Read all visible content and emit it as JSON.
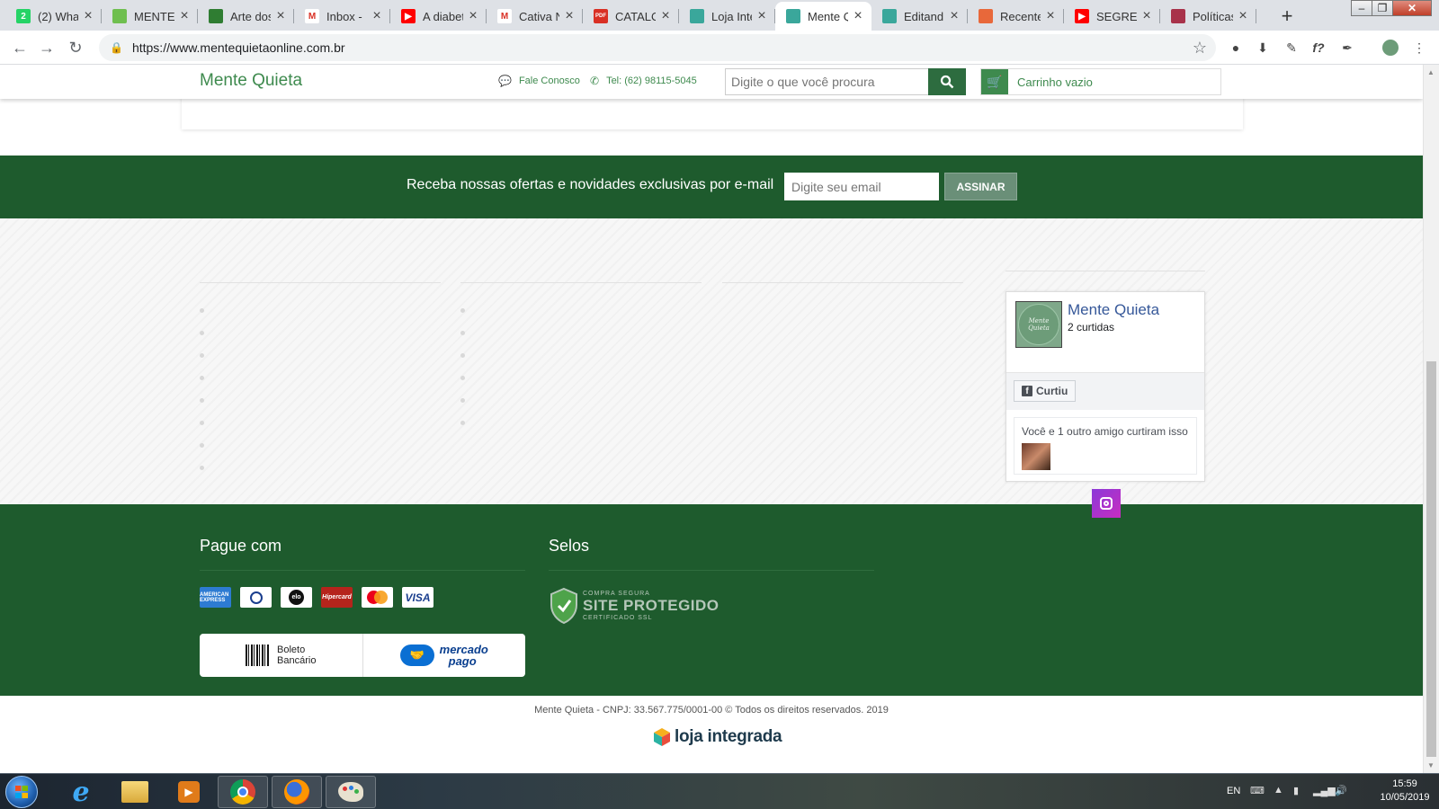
{
  "browser": {
    "tabs": [
      {
        "title": "(2) Wha",
        "favicon": "whatsapp-icon",
        "color": "#25d366",
        "glyph": "2"
      },
      {
        "title": "MENTEC",
        "favicon": "sheet-icon",
        "color": "#6fbf4f",
        "glyph": ""
      },
      {
        "title": "Arte dos",
        "favicon": "feather-icon",
        "color": "#2f7d32",
        "glyph": ""
      },
      {
        "title": "Inbox - ",
        "favicon": "gmail-icon",
        "color": "#ffffff",
        "glyph": "M"
      },
      {
        "title": "A diabet",
        "favicon": "youtube-icon",
        "color": "#ff0000",
        "glyph": "▶"
      },
      {
        "title": "Cativa N",
        "favicon": "gmail-icon",
        "color": "#ffffff",
        "glyph": "M"
      },
      {
        "title": "CATALO",
        "favicon": "pdf-icon",
        "color": "#d93025",
        "glyph": "PDF"
      },
      {
        "title": "Loja Inte",
        "favicon": "loja-integrada-icon",
        "color": "#3aa79b",
        "glyph": ""
      },
      {
        "title": "Mente Q",
        "favicon": "loja-integrada-icon",
        "color": "#3aa79b",
        "glyph": "",
        "active": true
      },
      {
        "title": "Editand",
        "favicon": "loja-integrada-icon",
        "color": "#3aa79b",
        "glyph": ""
      },
      {
        "title": "Recente",
        "favicon": "box-icon",
        "color": "#e8683a",
        "glyph": ""
      },
      {
        "title": "SEGRED",
        "favicon": "youtube-icon",
        "color": "#ff0000",
        "glyph": "▶"
      },
      {
        "title": "Políticas",
        "favicon": "leaf-icon",
        "color": "#a8324a",
        "glyph": ""
      }
    ],
    "url": "https://www.mentequietaonline.com.br"
  },
  "header": {
    "logo": "Mente Quieta",
    "contact_label": "Fale Conosco",
    "phone": "Tel: (62) 98115-5045",
    "search_placeholder": "Digite o que você procura",
    "cart_label": "Carrinho vazio"
  },
  "newsletter": {
    "text": "Receba nossas ofertas e novidades exclusivas por e-mail",
    "email_placeholder": "Digite seu email",
    "button": "ASSINAR"
  },
  "facebook": {
    "page_name": "Mente Quieta",
    "likes": "2 curtidas",
    "like_button": "Curtiu",
    "friends_text": "Você e 1 outro amigo curtiram isso",
    "avatar_text": "Mente Quieta"
  },
  "payment": {
    "title": "Pague com",
    "cards": [
      "AMERICAN EXPRESS",
      "Diners",
      "elo",
      "Hipercard",
      "mastercard",
      "VISA"
    ],
    "boleto": "Boleto Bancário",
    "boleto_line1": "Boleto",
    "boleto_line2": "Bancário",
    "mercado_line1": "mercado",
    "mercado_line2": "pago"
  },
  "seals": {
    "title": "Selos",
    "line1": "COMPRA SEGURA",
    "line2": "SITE PROTEGIDO",
    "line3": "CERTIFICADO SSL"
  },
  "footer": {
    "copyright": "Mente Quieta - CNPJ: 33.567.775/0001-00 © Todos os direitos reservados. 2019",
    "platform": "loja integrada"
  },
  "taskbar": {
    "lang": "EN",
    "time": "15:59",
    "date": "10/05/2019"
  },
  "colors": {
    "brand_green": "#1e5b2d",
    "logo_green": "#3e8a4e",
    "instagram": "#8b3ad8"
  }
}
